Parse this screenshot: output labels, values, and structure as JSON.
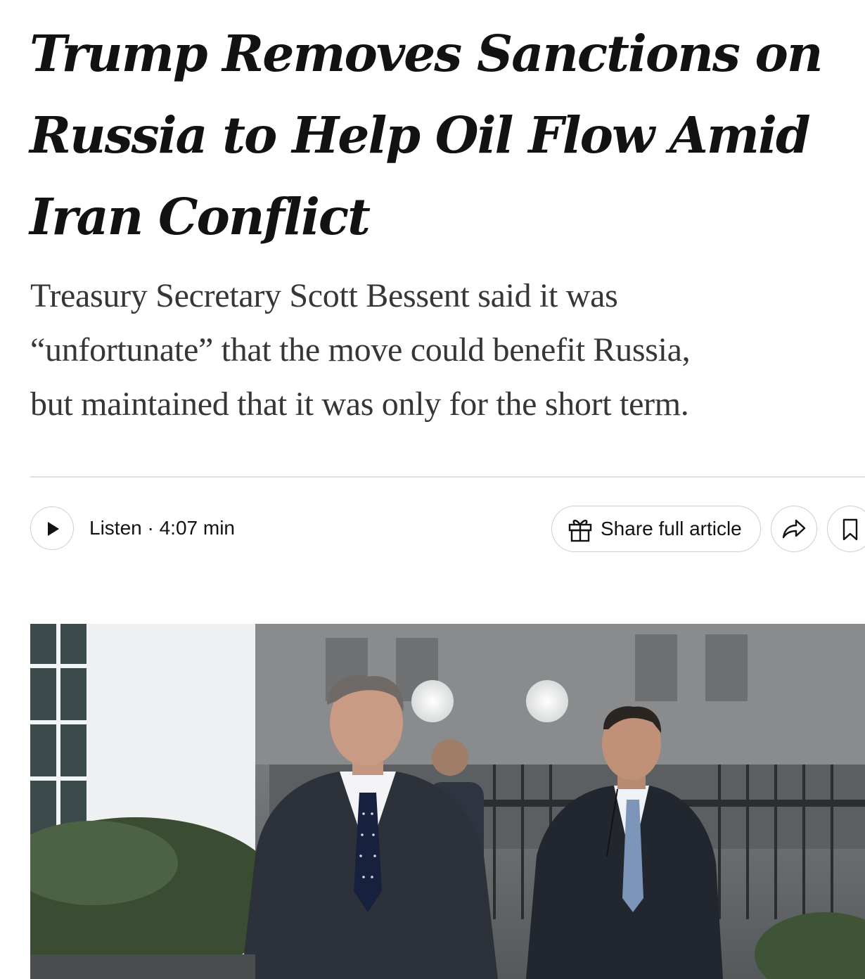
{
  "article": {
    "headline_lines": [
      "Trump Removes Sanctions on",
      "Russia to Help Oil Flow Amid",
      "Iran Conflict"
    ],
    "dek_lines": [
      "Treasury Secretary Scott Bessent said it was",
      "“unfortunate” that the move could benefit Russia,",
      "but maintained that it was only for the short term."
    ]
  },
  "toolbar": {
    "listen_label": "Listen · 4:07 min",
    "share_full_label": "Share full article",
    "icons": {
      "play": "play-icon",
      "gift": "gift-icon",
      "share": "share-arrow-icon",
      "save": "bookmark-icon"
    }
  },
  "colors": {
    "headline": "#121212",
    "dek": "#363636",
    "border": "#cfcfcf",
    "divider": "#dfdfdf"
  }
}
